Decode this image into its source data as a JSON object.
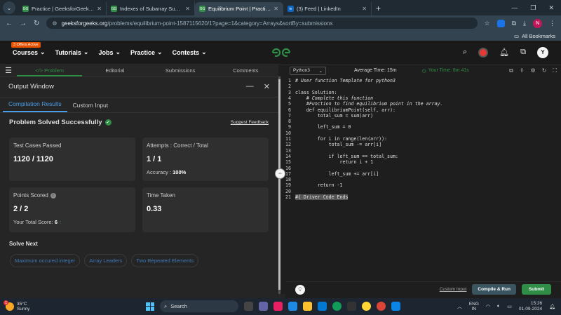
{
  "browser": {
    "tabs": [
      {
        "title": "Practice | GeeksforGeeks | A co",
        "favicon": "GfG",
        "active": false
      },
      {
        "title": "Indexes of Subarray Sum | Prac",
        "favicon": "GfG",
        "active": false
      },
      {
        "title": "Equilibrium Point | Practice | Ge",
        "favicon": "GfG",
        "active": true
      },
      {
        "title": "(3) Feed | LinkedIn",
        "favicon": "in",
        "active": false
      }
    ],
    "url_host": "geeksforgeeks.org",
    "url_path": "/problems/equilibrium-point-1587115620/1?page=1&category=Arrays&sortBy=submissions",
    "profile_initial": "N",
    "bookmarks_label": "All Bookmarks"
  },
  "gfg": {
    "offer_badge": "3 Offers Active",
    "menu": [
      "Courses",
      "Tutorials",
      "Jobs",
      "Practice",
      "Contests"
    ],
    "logo_text": "GfG",
    "user_initial": "Y"
  },
  "left_tabs": [
    {
      "label": "</> Problem",
      "active": true
    },
    {
      "label": "Editorial",
      "active": false
    },
    {
      "label": "Submissions",
      "active": false
    },
    {
      "label": "Comments",
      "active": false
    }
  ],
  "output": {
    "title": "Output Window",
    "tabs": [
      {
        "label": "Compilation Results",
        "active": true
      },
      {
        "label": "Custom Input",
        "active": false
      }
    ],
    "status": "Problem Solved Successfully",
    "feedback": "Suggest Feedback",
    "cards": {
      "test_cases_label": "Test Cases Passed",
      "test_cases_value": "1120 / 1120",
      "attempts_label": "Attempts : Correct / Total",
      "attempts_value": "1 / 1",
      "accuracy_label": "Accuracy :",
      "accuracy_value": "100%",
      "points_label": "Points Scored",
      "points_value": "2 / 2",
      "total_score_label": "Your Total Score:",
      "total_score_value": "6",
      "time_label": "Time Taken",
      "time_value": "0.33"
    },
    "solve_next_label": "Solve Next",
    "solve_next": [
      "Maximum occured integer",
      "Array Leaders",
      "Two Repeated Elements"
    ]
  },
  "editor": {
    "language": "Python3",
    "avg_time": "Average Time: 15m",
    "your_time": "Your Time: 8m 41s",
    "lines": [
      {
        "n": "1",
        "code": "# User function Template for python3"
      },
      {
        "n": "2",
        "code": ""
      },
      {
        "n": "3",
        "code": "class Solution:"
      },
      {
        "n": "4",
        "code": "    # Complete this function"
      },
      {
        "n": "5",
        "code": "    #Function to find equilibrium point in the array."
      },
      {
        "n": "6",
        "code": "    def equilibriumPoint(self, arr):"
      },
      {
        "n": "7",
        "code": "        total_sum = sum(arr)"
      },
      {
        "n": "8",
        "code": ""
      },
      {
        "n": "9",
        "code": "        left_sum = 0"
      },
      {
        "n": "10",
        "code": ""
      },
      {
        "n": "11",
        "code": "        for i in range(len(arr)):"
      },
      {
        "n": "12",
        "code": "            total_sum -= arr[i]"
      },
      {
        "n": "13",
        "code": ""
      },
      {
        "n": "14",
        "code": "            if left_sum == total_sum:"
      },
      {
        "n": "15",
        "code": "                return i + 1"
      },
      {
        "n": "16",
        "code": ""
      },
      {
        "n": "17",
        "code": "            left_sum += arr[i]"
      },
      {
        "n": "18",
        "code": ""
      },
      {
        "n": "19",
        "code": "        return -1"
      },
      {
        "n": "20",
        "code": ""
      },
      {
        "n": "21",
        "code": "#{ Driver Code Ends"
      }
    ],
    "custom_input": "Custom Input",
    "compile_run": "Compile & Run",
    "submit": "Submit"
  },
  "taskbar": {
    "temp": "35°C",
    "weather": "Sunny",
    "search": "Search",
    "lang1": "ENG",
    "lang2": "IN",
    "time": "15:26",
    "date": "01-09-2024"
  },
  "colors": {
    "gfg_green": "#2f8d46",
    "link_blue": "#4a9ee8"
  }
}
